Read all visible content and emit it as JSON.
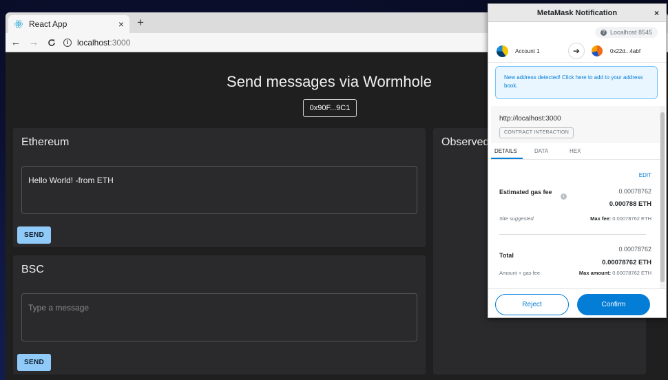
{
  "browser": {
    "tab_title": "React App",
    "tab_close": "×",
    "new_tab": "+",
    "url_host": "localhost",
    "url_port": ":3000",
    "back": "←",
    "forward": "→",
    "reload": "C"
  },
  "page": {
    "title": "Send messages via Wormhole",
    "address_button": "0x90F...9C1",
    "ethereum": {
      "title": "Ethereum",
      "message_value": "Hello World! -from ETH",
      "send_label": "SEND"
    },
    "bsc": {
      "title": "BSC",
      "message_placeholder": "Type a message",
      "send_label": "SEND"
    },
    "observed_title": "Observed"
  },
  "metamask": {
    "title": "MetaMask Notification",
    "close": "×",
    "network": "Localhost 8545",
    "from_account": "Account 1",
    "to_account": "0x22d...4abf",
    "banner": "New address detected! Click here to add to your address book.",
    "origin": "http://localhost:3000",
    "contract_badge": "CONTRACT INTERACTION",
    "tabs": [
      "DETAILS",
      "DATA",
      "HEX"
    ],
    "edit_label": "EDIT",
    "gas": {
      "label": "Estimated gas fee",
      "value_small": "0.00078762",
      "value_main": "0.000788 ETH",
      "site_suggested": "Site suggested",
      "max_fee_label": "Max fee:",
      "max_fee_value": "0.00078762 ETH"
    },
    "total": {
      "label": "Total",
      "value_small": "0.00078762",
      "value_main": "0.00078762 ETH",
      "amount_gas": "Amount + gas fee",
      "max_amount_label": "Max amount:",
      "max_amount_value": "0.00078762 ETH"
    },
    "reject_label": "Reject",
    "confirm_label": "Confirm",
    "colors": {
      "primary": "#037dd6",
      "banner_bg": "#eaf6ff"
    }
  }
}
